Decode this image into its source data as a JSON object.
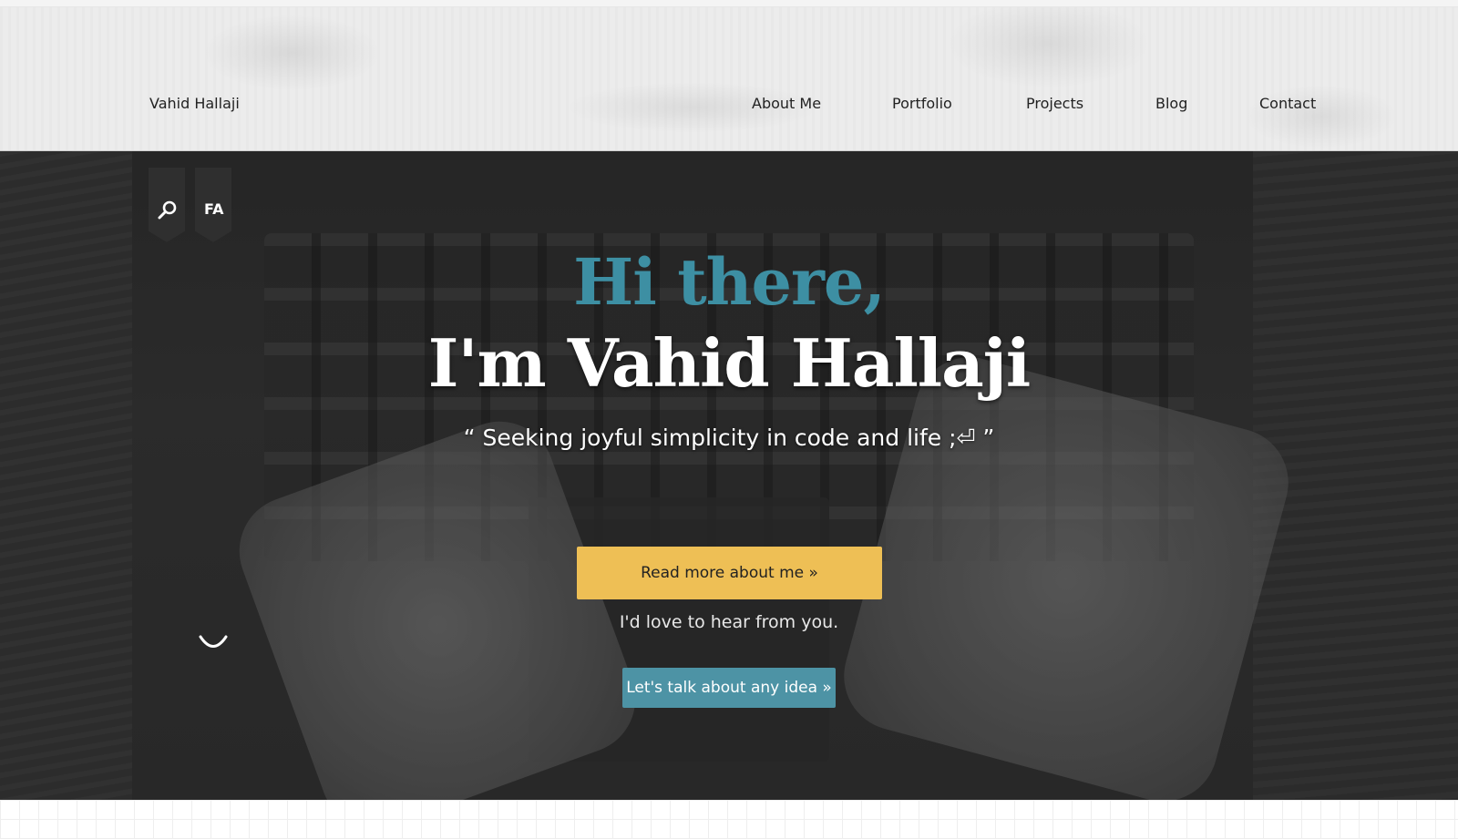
{
  "header": {
    "brand": "Vahid Hallaji",
    "nav": [
      {
        "label": "About Me"
      },
      {
        "label": "Portfolio"
      },
      {
        "label": "Projects"
      },
      {
        "label": "Blog"
      },
      {
        "label": "Contact"
      }
    ]
  },
  "hero": {
    "search_icon": "search-icon",
    "lang_label": "FA",
    "greeting": "Hi there,",
    "name": "I'm Vahid Hallaji",
    "tagline": "“ Seeking joyful simplicity in code and life ;⏎ ”",
    "primary_button": "Read more about me »",
    "contact_prompt": "I'd love to hear from you.",
    "secondary_button": "Let's talk about any idea »",
    "scroll_icon": "chevron-down-icon"
  },
  "colors": {
    "accent_teal": "#3d8fa3",
    "button_yellow": "#eebf55",
    "button_teal": "#4d93a5"
  }
}
